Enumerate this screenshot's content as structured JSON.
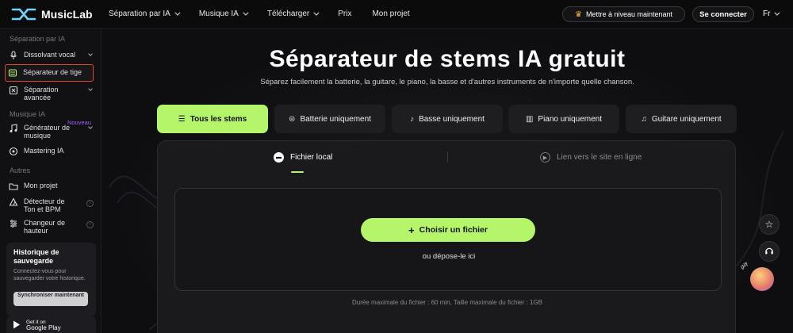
{
  "app": {
    "name": "MusicLab"
  },
  "topnav": {
    "items": [
      {
        "label": "Séparation par IA",
        "has_dropdown": true
      },
      {
        "label": "Musique IA",
        "has_dropdown": true
      },
      {
        "label": "Télécharger",
        "has_dropdown": true
      },
      {
        "label": "Prix",
        "has_dropdown": false
      },
      {
        "label": "Mon projet",
        "has_dropdown": false
      }
    ],
    "upgrade_label": "Mettre à niveau maintenant",
    "login_label": "Se connecter",
    "language": "Fr"
  },
  "sidebar": {
    "sections": [
      {
        "title": "Séparation par IA"
      },
      {
        "title": "Musique IA"
      },
      {
        "title": "Autres"
      }
    ],
    "items": [
      {
        "label": "Dissolvant vocal",
        "icon": "microphone-icon"
      },
      {
        "label": "Séparateur de tige",
        "icon": "stems-icon",
        "active": true
      },
      {
        "label": "Séparation avancée",
        "icon": "advanced-icon"
      },
      {
        "label": "Générateur de musique",
        "icon": "music-generator-icon",
        "badge": "Nouveau"
      },
      {
        "label": "Mastering IA",
        "icon": "mastering-icon"
      },
      {
        "label": "Mon projet",
        "icon": "folder-icon"
      },
      {
        "label": "Détecteur de Ton et BPM",
        "icon": "tuner-icon"
      },
      {
        "label": "Changeur de hauteur",
        "icon": "pitch-icon"
      }
    ],
    "history": {
      "title": "Historique de sauvegarde",
      "description": "Connectez-vous pour sauvegarder votre historique.",
      "sync_label": "Synchroniser maintenant"
    },
    "google_play": {
      "line1": "Get it on",
      "line2": "Google Play"
    }
  },
  "hero": {
    "title": "Séparateur de stems IA gratuit",
    "subtitle": "Séparez facilement la batterie, la guitare, le piano, la basse et d'autres instruments de n'importe quelle chanson."
  },
  "stem_tabs": [
    {
      "label": "Tous les stems",
      "icon": "list-icon",
      "active": true
    },
    {
      "label": "Batterie uniquement",
      "icon": "drum-icon",
      "active": false
    },
    {
      "label": "Basse uniquement",
      "icon": "bass-icon",
      "active": false
    },
    {
      "label": "Piano uniquement",
      "icon": "piano-icon",
      "active": false
    },
    {
      "label": "Guitare uniquement",
      "icon": "guitar-icon",
      "active": false
    }
  ],
  "upload": {
    "tab_local": "Fichier local",
    "tab_online": "Lien vers le site en ligne",
    "choose_label": "Choisir un fichier",
    "drop_hint": "ou dépose-le ici",
    "limits": "Durée maximale du fichier : 60 min, Taille maximale du fichier : 1GB"
  },
  "floating": {
    "gift_label": "gift"
  },
  "colors": {
    "accent": "#b4f56a",
    "highlight_border": "#e5442d",
    "badge": "#a35cff",
    "crown": "#f5b73b"
  }
}
